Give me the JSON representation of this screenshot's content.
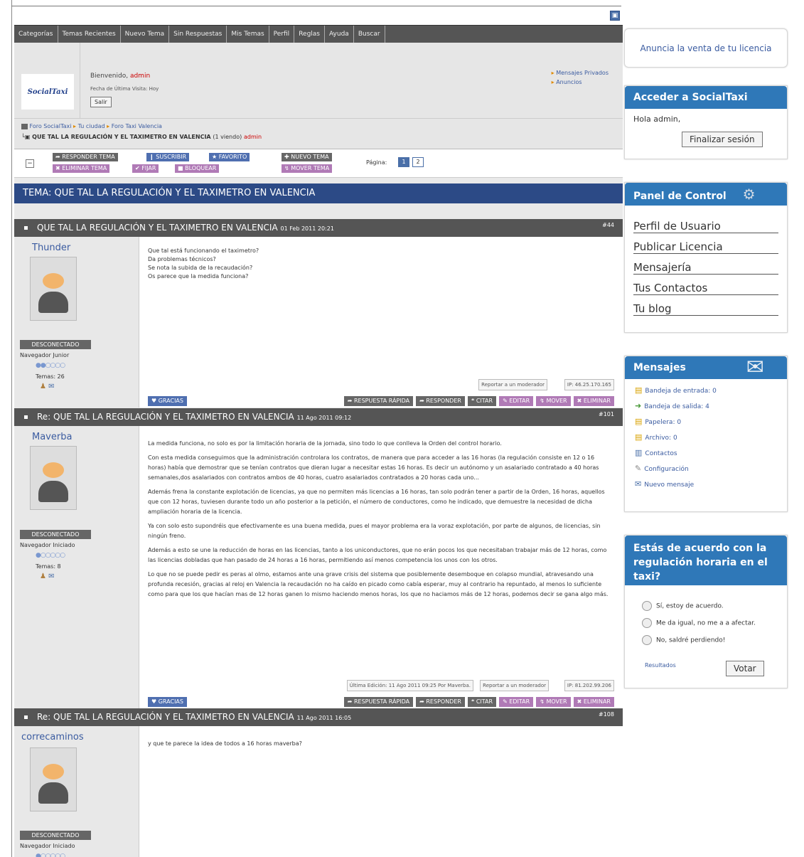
{
  "nav": {
    "tabs": [
      "Categorías",
      "Temas Recientes",
      "Nuevo Tema",
      "Sin Respuestas",
      "Mis Temas",
      "Perfil",
      "Reglas",
      "Ayuda",
      "Buscar"
    ]
  },
  "header": {
    "logo": "SocialTaxi",
    "welcome": "Bienvenido,",
    "user": "admin",
    "last_visit": "Fecha de Última Visita: Hoy",
    "logout": "Salir",
    "links": [
      "Mensajes Privados",
      "Anuncios"
    ]
  },
  "breadcrumb": {
    "items": [
      "Foro SocialTaxi",
      "Tu ciudad",
      "Foro Taxi Valencia"
    ],
    "topic": "QUE TAL LA REGULACIÓN Y EL TAXIMETRO EN VALENCIA",
    "viewing": "(1 viendo)",
    "viewer": "admin"
  },
  "actions": {
    "reply_topic": "RESPONDER TEMA",
    "subscribe": "SUSCRIBIR",
    "favorite": "FAVORITO",
    "new_topic": "NUEVO TEMA",
    "delete_topic": "ELIMINAR TEMA",
    "pin": "FIJAR",
    "lock": "BLOQUEAR",
    "move_topic": "MOVER TEMA",
    "page_label": "Página:",
    "pages": [
      "1",
      "2"
    ]
  },
  "topic_title": "TEMA: QUE TAL LA REGULACIÓN Y EL TAXIMETRO EN VALENCIA",
  "post_buttons": {
    "thanks": "GRACIAS",
    "quick_reply": "RESPUESTA RÁPIDA",
    "reply": "RESPONDER",
    "quote": "CITAR",
    "edit": "EDITAR",
    "move": "MOVER",
    "delete": "ELIMINAR",
    "report": "Reportar a un moderador"
  },
  "posts": [
    {
      "title": "QUE TAL LA REGULACIÓN Y EL TAXIMETRO EN VALENCIA",
      "date": "01 Feb 2011 20:21",
      "num": "#44",
      "user": "Thunder",
      "status": "DESCONECTADO",
      "rank": "Navegador Junior",
      "topics": "Temas: 26",
      "ip": "IP: 46.25.170.165",
      "body": [
        "Que tal está funcionando el taximetro?",
        "Da problemas técnicos?",
        "Se nota la subida de la recaudación?",
        "Os parece que la medida funciona?"
      ]
    },
    {
      "title": "Re: QUE TAL LA REGULACIÓN Y EL TAXIMETRO EN VALENCIA",
      "date": "11 Ago 2011 09:12",
      "num": "#101",
      "user": "Maverba",
      "status": "DESCONECTADO",
      "rank": "Navegador Iniciado",
      "topics": "Temas: 8",
      "ip": "IP: 81.202.99.206",
      "edit": "Última Edición: 11 Ago 2011 09:25 Por Maverba.",
      "body": [
        "La medida funciona, no solo es por la limitación horaria de la jornada, sino todo lo que conlleva la Orden del control horario.",
        "Con esta medida conseguimos que la administración controlara los contratos, de manera que para acceder a las 16 horas (la regulación consiste en 12 o 16 horas) había que demostrar que se tenían contratos que dieran lugar a necesitar estas 16 horas. Es decir un autónomo y un asalariado contratado a 40 horas semanales,dos asalariados con contratos ambos de 40 horas, cuatro asalariados contratados a 20 horas cada uno...",
        "Además frena la constante explotación de licencias, ya que no permiten más licencias a 16 horas, tan solo podrán tener a partir de la Orden, 16 horas, aquellos que con 12 horas, tuviesen durante todo un año posterior a la petición, el número de conductores, como he indicado, que demuestre la necesidad de dicha ampliación horaria de la licencia.",
        "Ya con solo esto supondréis que efectivamente es una buena medida, pues el mayor problema era la voraz explotación, por parte de algunos, de licencias, sin ningún freno.",
        "Además a esto se une la reducción de horas en las licencias, tanto a los uniconductores, que no erán pocos los que necesitaban trabajar más de 12 horas, como las licencias dobladas que han pasado de 24 horas a 16 horas, permitiendo así menos competencia los unos con los otros.",
        "Lo que no se puede pedir es peras al olmo, estamos ante una grave crisis del sistema que posiblemente desemboque en colapso mundial, atravesando una profunda recesión, gracias al reloj en Valencia la recaudación no ha caído en picado como cabía esperar, muy al contrario ha repuntado, al menos lo suficiente como para que los que hacían mas de 12 horas ganen lo mismo haciendo menos horas, los que no haciamos más de 12 horas, podemos decir se gana algo más."
      ]
    },
    {
      "title": "Re: QUE TAL LA REGULACIÓN Y EL TAXIMETRO EN VALENCIA",
      "date": "11 Ago 2011 16:05",
      "num": "#108",
      "user": "correcaminos",
      "status": "DESCONECTADO",
      "rank": "Navegador Iniciado",
      "body": [
        "y que te parece la idea de todos a 16 horas maverba?"
      ]
    }
  ],
  "sidebar": {
    "ad": "Anuncia la venta de tu licencia",
    "login": {
      "title": "Acceder a SocialTaxi",
      "hello": "Hola admin,",
      "button": "Finalizar sesión"
    },
    "panel": {
      "title": "Panel de Control",
      "links": [
        "Perfil de Usuario",
        "Publicar Licencia",
        "Mensajería",
        "Tus Contactos",
        "Tu blog"
      ]
    },
    "messages": {
      "title": "Mensajes",
      "items": [
        "Bandeja de entrada: 0",
        "Bandeja de salida: 4",
        "Papelera: 0",
        "Archivo: 0",
        "Contactos",
        "Configuración",
        "Nuevo mensaje"
      ]
    },
    "poll": {
      "title": "Estás de acuerdo con la regulación horaria en el taxi?",
      "options": [
        "Sí, estoy de acuerdo.",
        "Me da igual, no me a a afectar.",
        "No, saldré perdiendo!"
      ],
      "results": "Resultados",
      "vote": "Votar"
    }
  },
  "colors": {
    "nav": "#555555",
    "topic": "#2c4a86",
    "sidebar_head": "#2f78b8",
    "link": "#3a5ba0"
  }
}
